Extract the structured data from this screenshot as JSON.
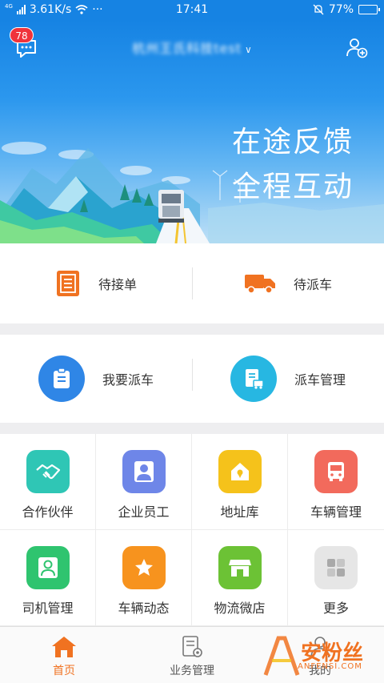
{
  "status_bar": {
    "network_tag": "4G",
    "speed": "3.61K/s",
    "dots": "···",
    "time": "17:41",
    "battery": "77%",
    "battery_level": 0.77
  },
  "header": {
    "message_badge": "78",
    "company_name": "杭州王氏科技test",
    "slogan_line1": "在途反馈",
    "slogan_line2": "全程互动"
  },
  "task_row": [
    {
      "label": "待接单",
      "icon": "order-doc-icon"
    },
    {
      "label": "待派车",
      "icon": "truck-icon"
    }
  ],
  "dispatch_row": [
    {
      "label": "我要派车",
      "icon": "clipboard-icon",
      "color": "#2f86e6"
    },
    {
      "label": "派车管理",
      "icon": "manage-doc-icon",
      "color": "#27b7e2"
    }
  ],
  "grid": [
    {
      "label": "合作伙伴",
      "icon": "handshake-icon",
      "color": "#2fc6b5"
    },
    {
      "label": "企业员工",
      "icon": "employee-icon",
      "color": "#6e86e8"
    },
    {
      "label": "地址库",
      "icon": "address-house-icon",
      "color": "#f5c21b"
    },
    {
      "label": "车辆管理",
      "icon": "bus-icon",
      "color": "#f26a5c"
    },
    {
      "label": "司机管理",
      "icon": "driver-icon",
      "color": "#2fc46f"
    },
    {
      "label": "车辆动态",
      "icon": "star-icon",
      "color": "#f7931e"
    },
    {
      "label": "物流微店",
      "icon": "shop-icon",
      "color": "#6cc235"
    },
    {
      "label": "更多",
      "icon": "more-grid-icon",
      "color": "#e6e6e6"
    }
  ],
  "tabs": [
    {
      "label": "首页",
      "icon": "home-icon",
      "active": true
    },
    {
      "label": "业务管理",
      "icon": "business-icon",
      "active": false
    },
    {
      "label": "我的",
      "icon": "person-icon",
      "active": false
    }
  ],
  "watermark": {
    "text": "安粉丝",
    "sub": "ANFENSI.COM"
  },
  "colors": {
    "accent": "#f07221",
    "banner_blue": "#1683e3"
  }
}
